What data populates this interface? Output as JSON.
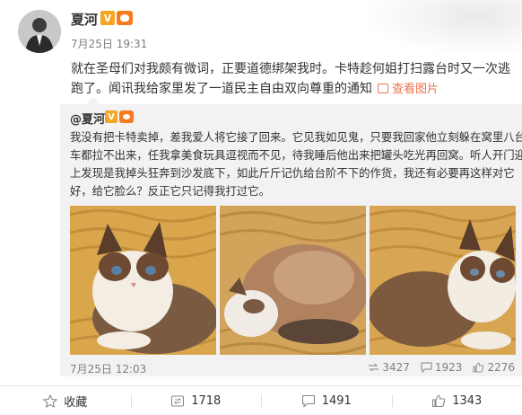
{
  "post": {
    "username": "夏河",
    "verified_badge": "V",
    "time": "7月25日 19:31",
    "text_lines": [
      "就在圣母们对我颇有微词，正要道德绑架我时。卡特趁何姐打扫露台时又一次逃",
      "跑了。闻讯我给家里发了一道民主自由双向尊重的通知"
    ],
    "view_image_label": "查看图片"
  },
  "repost": {
    "username": "@夏河",
    "verified_badge": "V",
    "text_lines": [
      "我没有把卡特卖掉，差我爱人将它接了回来。它见我如见鬼，只要我回家他立刻躲在窝里八台",
      "车都拉不出来，任我拿美食玩具逗视而不见，待我睡后他出来把罐头吃光再回窝。听人开门迎",
      "上发现是我掉头狂奔到沙发底下，如此斤斤记仇给台阶不下的作货，我还有必要再这样对它",
      "好，给它脸么？反正它只记得我打过它。"
    ],
    "time": "7月25日 12:03",
    "repost_count": "3427",
    "comment_count": "1923",
    "like_count": "2276"
  },
  "actions": {
    "favorite_label": "收藏",
    "repost_count": "1718",
    "comment_count": "1491",
    "like_count": "1343"
  },
  "icons": {
    "avatar": "user-avatar",
    "verified": "verified-v-icon",
    "level": "member-level-icon",
    "view_image": "image-icon",
    "favorite": "star-icon",
    "repost": "repost-icon",
    "comment": "comment-icon",
    "like": "thumbs-up-icon"
  },
  "colors": {
    "accent": "#eb7350",
    "verified": "#f5a623",
    "repost_bg": "#f2f2f5",
    "muted_text": "#808080"
  }
}
